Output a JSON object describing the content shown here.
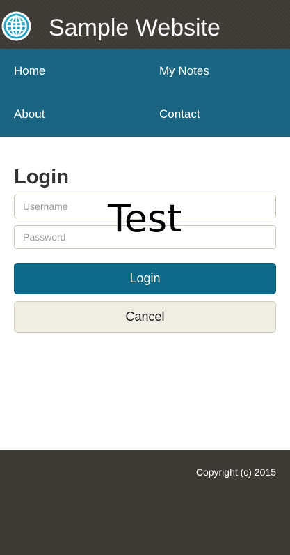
{
  "header": {
    "logo_icon": "globe-icon",
    "title": "Sample Website",
    "background": "#3f3a33"
  },
  "nav": {
    "background": "#1a6682",
    "items": [
      {
        "label": "Home"
      },
      {
        "label": "My Notes"
      },
      {
        "label": "About"
      },
      {
        "label": "Contact"
      }
    ]
  },
  "login": {
    "title": "Login",
    "username_placeholder": "Username",
    "password_placeholder": "Password",
    "login_button": "Login",
    "cancel_button": "Cancel",
    "overlay_text": "Test",
    "login_color": "#0e6b8a",
    "cancel_color": "#f0ede2"
  },
  "footer": {
    "copyright": "Copyright (c) 2015"
  }
}
